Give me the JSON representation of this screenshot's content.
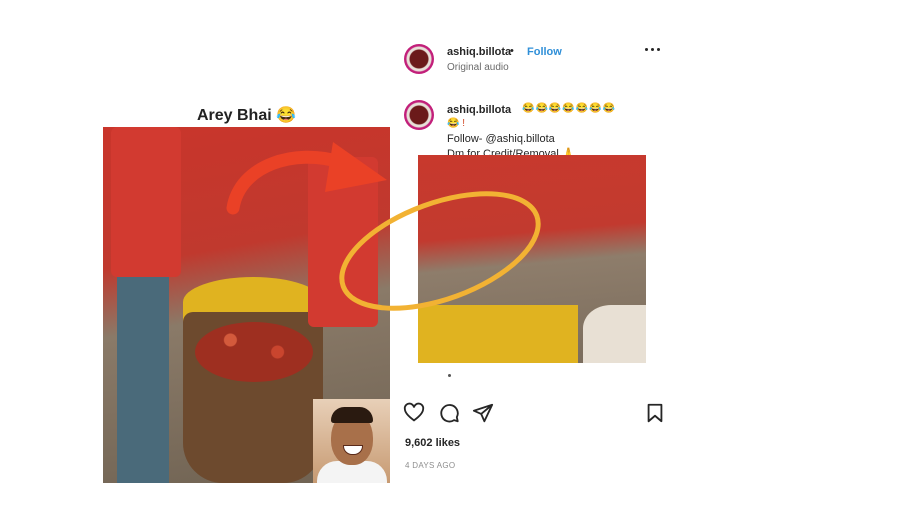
{
  "left": {
    "caption": "Arey Bhai 😂"
  },
  "post": {
    "username": "ashiq.billota",
    "separator": "•",
    "follow_label": "Follow",
    "audio": "Original audio",
    "caption_username": "ashiq.billota",
    "caption_emojis": "😂😂😂😂😂😂😂",
    "caption_emojis_line2": "😂 !",
    "caption_follow": "Follow- @ashiq.billota",
    "caption_dm": "Dm for Credit/Removal 🙏",
    "likes": "9,602 likes",
    "time": "4 DAYS AGO"
  },
  "icons": [
    "more-icon",
    "heart-icon",
    "comment-icon",
    "share-icon",
    "bookmark-icon"
  ],
  "colors": {
    "accent_blue": "#2f8fd8",
    "arrow_red": "#ea4126",
    "circle_yellow": "#f2b233"
  }
}
